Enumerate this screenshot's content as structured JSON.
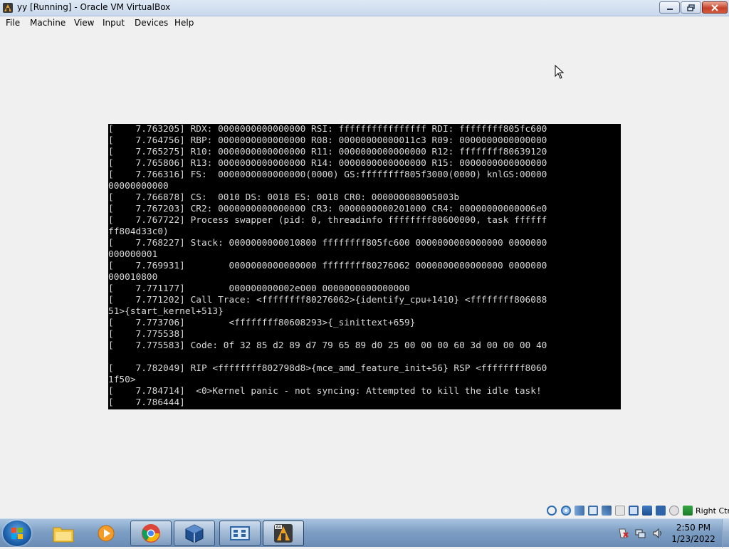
{
  "window": {
    "title": "yy [Running] - Oracle VM VirtualBox"
  },
  "menu": {
    "items": [
      "File",
      "Machine",
      "View",
      "Input",
      "Devices",
      "Help"
    ]
  },
  "console": {
    "lines": [
      "[    7.763205] RDX: 0000000000000000 RSI: ffffffffffffffff RDI: ffffffff805fc600",
      "[    7.764756] RBP: 0000000000000000 R08: 00000000000011c3 R09: 0000000000000000",
      "[    7.765275] R10: 0000000000000000 R11: 0000000000000000 R12: ffffffff80639120",
      "[    7.765806] R13: 0000000000000000 R14: 0000000000000000 R15: 0000000000000000",
      "[    7.766316] FS:  0000000000000000(0000) GS:ffffffff805f3000(0000) knlGS:00000",
      "00000000000",
      "[    7.766878] CS:  0010 DS: 0018 ES: 0018 CR0: 000000008005003b",
      "[    7.767203] CR2: 0000000000000000 CR3: 0000000000201000 CR4: 00000000000006e0",
      "[    7.767722] Process swapper (pid: 0, threadinfo ffffffff80600000, task ffffff",
      "ff804d33c0)",
      "[    7.768227] Stack: 0000000000010800 ffffffff805fc600 0000000000000000 0000000",
      "000000001",
      "[    7.769931]        0000000000000000 ffffffff80276062 0000000000000000 0000000",
      "000010800",
      "[    7.771177]        000000000002e000 0000000000000000",
      "[    7.771202] Call Trace: <ffffffff80276062>{identify_cpu+1410} <ffffffff806088",
      "51>{start_kernel+513}",
      "[    7.773706]        <ffffffff80608293>{_sinittext+659}",
      "[    7.775538]",
      "[    7.775583] Code: 0f 32 85 d2 89 d7 79 65 89 d0 25 00 00 00 60 3d 00 00 00 40",
      "",
      "[    7.782049] RIP <ffffffff802798d8>{mce_amd_feature_init+56} RSP <ffffffff8060",
      "1f50>",
      "[    7.784714]  <0>Kernel panic - not syncing: Attempted to kill the idle task!",
      "[    7.786444]"
    ]
  },
  "statusbar": {
    "host_key": "Right Ctrl",
    "icons": [
      "hard-disk-icon",
      "optical-drive-icon",
      "audio-icon",
      "network-icon",
      "usb-icon",
      "shared-folders-icon",
      "display-icon",
      "video-capture-icon",
      "vt-x-icon",
      "mouse-integration-icon",
      "host-key-icon"
    ]
  },
  "taskbar": {
    "apps": [
      "file-explorer-icon",
      "media-player-icon",
      "chrome-icon",
      "virtualbox-icon",
      "network-manager-icon",
      "vm-window-icon"
    ],
    "clock_time": "2:50 PM",
    "clock_date": "1/23/2022",
    "tray_icons": [
      "action-center-icon",
      "network-tray-icon",
      "volume-icon"
    ]
  }
}
